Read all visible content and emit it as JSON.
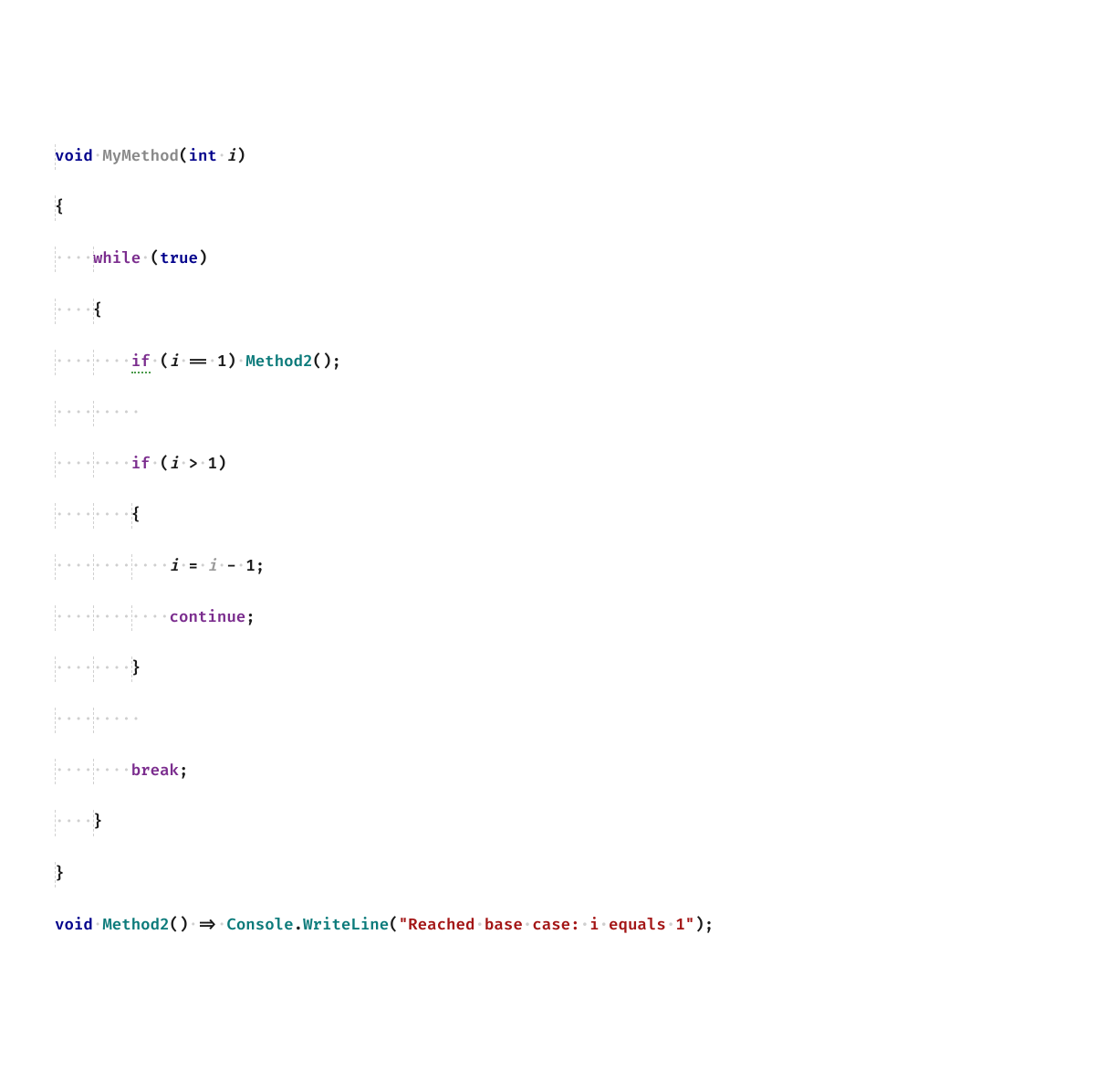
{
  "tokens": {
    "void": "void",
    "int": "int",
    "while": "while",
    "true": "true",
    "if": "if",
    "continue": "continue",
    "break": "break",
    "MyMethod": "MyMethod",
    "Method2": "Method2",
    "Console": "Console",
    "WriteLine": "WriteLine",
    "i": "i",
    "n1": "1",
    "eq": "==",
    "gt": ">",
    "assign": "=",
    "minus": "-",
    "arrow": "=>",
    "lparen": "(",
    "rparen": ")",
    "lbrace": "{",
    "rbrace": "}",
    "semi": ";",
    "dot": ".",
    "string_literal": "\"Reached base case: i equals 1\""
  },
  "whitespace": {
    "dot1": "·",
    "dots4": "····",
    "dots8": "········",
    "dots9": "·········",
    "dots12": "············"
  },
  "colors": {
    "keyword_blue": "#00008b",
    "keyword_purple": "#7b2d8e",
    "method_gray": "#888888",
    "method_teal": "#0b7a7a",
    "string_red": "#a31515",
    "whitespace": "#cfcfcf"
  }
}
